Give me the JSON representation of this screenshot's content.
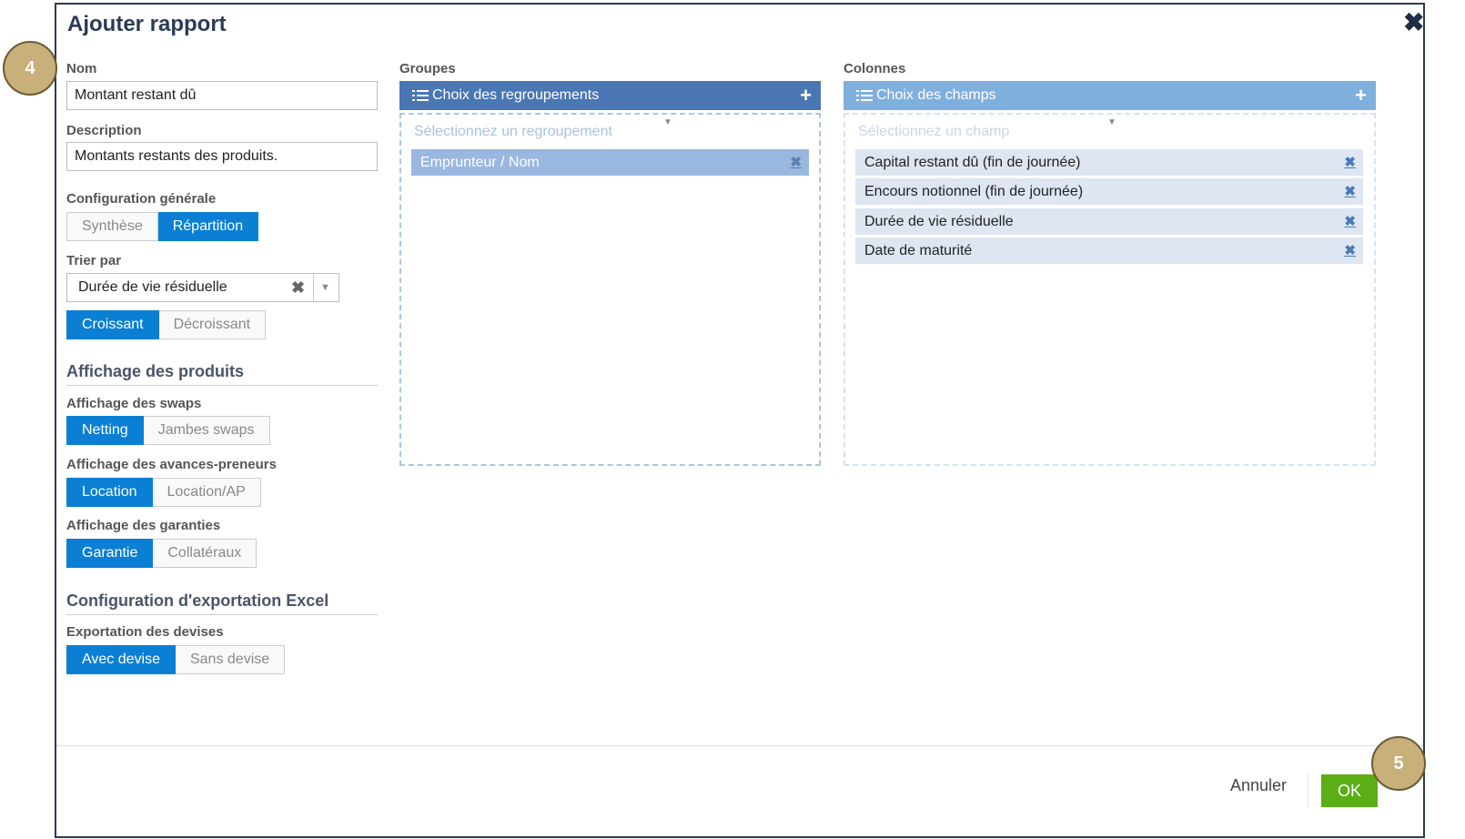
{
  "dialog": {
    "title": "Ajouter rapport",
    "close": "✖"
  },
  "form": {
    "nom_label": "Nom",
    "nom_value": "Montant restant dû",
    "description_label": "Description",
    "description_value": "Montants restants des produits.",
    "config_label": "Configuration générale",
    "config_options": [
      "Synthèse",
      "Répartition"
    ],
    "config_selected": "Répartition",
    "sort_label": "Trier par",
    "sort_value": "Durée de vie résiduelle",
    "sort_clear": "✖",
    "sort_arrow": "▼",
    "order_options": [
      "Croissant",
      "Décroissant"
    ],
    "order_selected": "Croissant",
    "products_section": "Affichage des produits",
    "swaps_label": "Affichage des swaps",
    "swaps_options": [
      "Netting",
      "Jambes swaps"
    ],
    "swaps_selected": "Netting",
    "avances_label": "Affichage des avances-preneurs",
    "avances_options": [
      "Location",
      "Location/AP"
    ],
    "avances_selected": "Location",
    "garanties_label": "Affichage des garanties",
    "garanties_options": [
      "Garantie",
      "Collatéraux"
    ],
    "garanties_selected": "Garantie",
    "excel_section": "Configuration d'exportation Excel",
    "devises_label": "Exportation des devises",
    "devises_options": [
      "Avec devise",
      "Sans devise"
    ],
    "devises_selected": "Avec devise"
  },
  "groups": {
    "label": "Groupes",
    "header": "Choix des regroupements",
    "add": "+",
    "placeholder": "Sélectionnez un regroupement",
    "caret": "▼",
    "items": [
      "Emprunteur / Nom"
    ],
    "remove": "✖"
  },
  "columns": {
    "label": "Colonnes",
    "header": "Choix des champs",
    "add": "+",
    "placeholder": "Sélectionnez un champ",
    "caret": "▼",
    "items": [
      "Capital restant dû (fin de journée)",
      "Encours notionnel (fin de journée)",
      "Durée de vie résiduelle",
      "Date de maturité"
    ],
    "remove": "✖"
  },
  "footer": {
    "cancel": "Annuler",
    "ok": "OK"
  },
  "callouts": [
    "4",
    "5"
  ],
  "colors": {
    "primary": "#0a7fd4",
    "groups_header": "#4a76b3",
    "columns_header": "#7fb0dd",
    "ok": "#5cae16",
    "callout": "#c8b07a"
  }
}
